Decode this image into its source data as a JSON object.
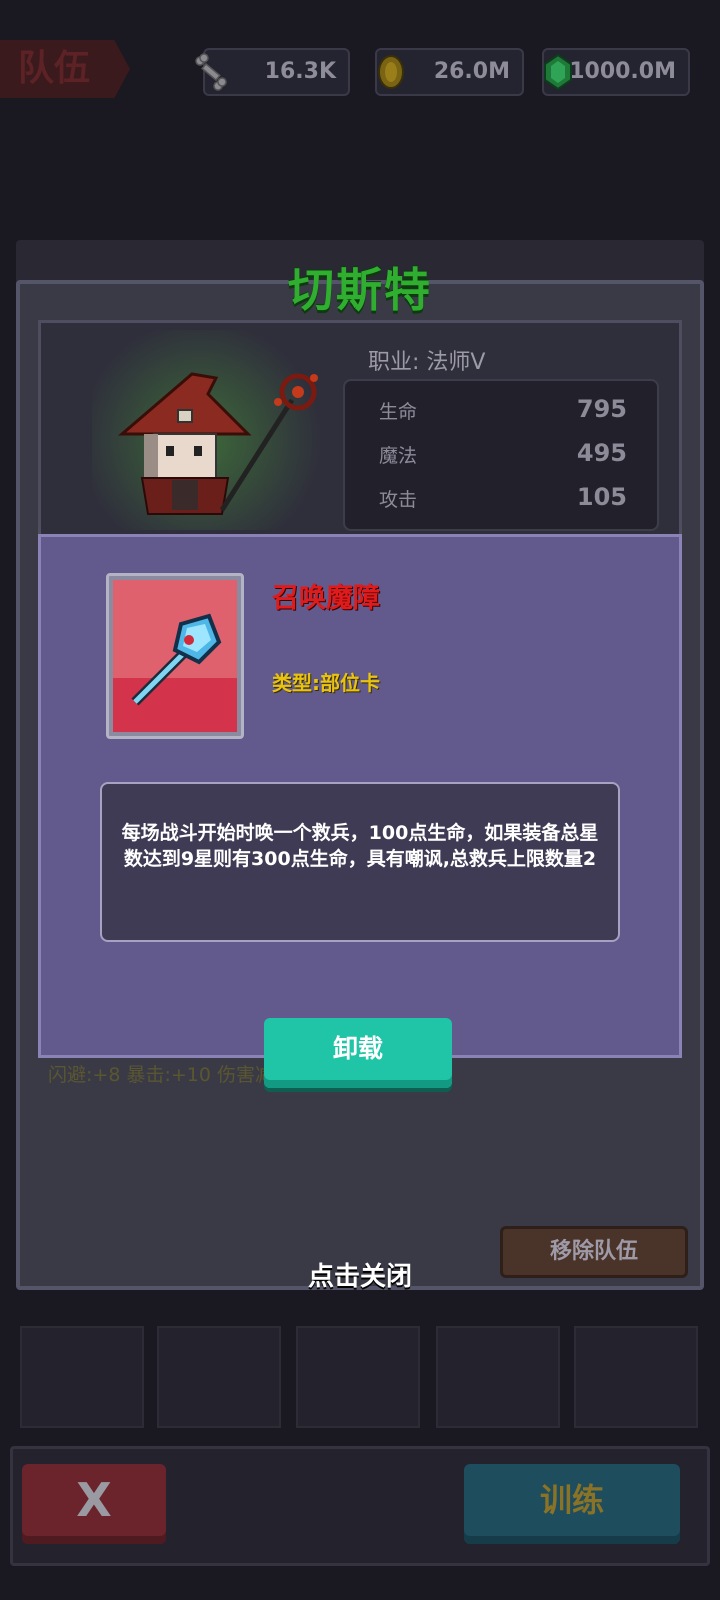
{
  "header": {
    "team_tab": "队伍",
    "resources": [
      {
        "icon": "bone-icon",
        "value": "16.3K"
      },
      {
        "icon": "gold-coin-icon",
        "value": "26.0M"
      },
      {
        "icon": "green-gem-icon",
        "value": "1000.0M"
      }
    ]
  },
  "hero": {
    "name": "切斯特",
    "job_label": "职业:",
    "job_value": "法师V",
    "stats": [
      {
        "label": "生命",
        "value": "795"
      },
      {
        "label": "魔法",
        "value": "495"
      },
      {
        "label": "攻击",
        "value": "105"
      }
    ],
    "extra_stats": "闪避:+8  暴击:+10  伤害减少:+20%"
  },
  "item_popup": {
    "name": "召唤魔障",
    "type": "类型:部位卡",
    "description": "每场战斗开始时唤一个救兵，100点生命，如果装备总星数达到9星则有300点生命，具有嘲讽,总救兵上限数量2",
    "unload_button": "卸载"
  },
  "remove_button": "移除队伍",
  "close_hint": "点击关闭",
  "bottom": {
    "close_button": "X",
    "train_button": "训练"
  },
  "colors": {
    "title_green": "#2fae2f",
    "item_name_red": "#e01b1b",
    "item_type_yellow": "#e8c40e",
    "popup_bg": "#62598c",
    "unload_teal": "#20c4a6"
  }
}
